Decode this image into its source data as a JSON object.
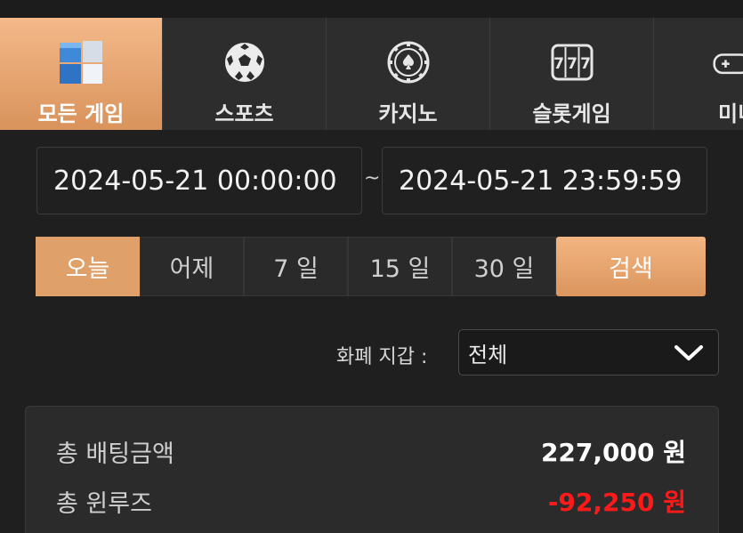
{
  "tabs": [
    {
      "label": "모든 게임",
      "icon": "all-games-cube-icon",
      "active": true
    },
    {
      "label": "스포츠",
      "icon": "soccer-ball-icon",
      "active": false
    },
    {
      "label": "카지노",
      "icon": "casino-chip-icon",
      "active": false
    },
    {
      "label": "슬롯게임",
      "icon": "slot-machine-icon",
      "active": false
    },
    {
      "label": "미니",
      "icon": "gamepad-icon",
      "active": false
    }
  ],
  "date_range": {
    "start": "2024-05-21 00:00:00",
    "separator": "~",
    "end": "2024-05-21 23:59:59"
  },
  "periods": [
    "오늘",
    "어제",
    "7 일",
    "15 일",
    "30 일"
  ],
  "active_period": "오늘",
  "search_label": "검색",
  "currency_filter": {
    "label": "화폐 지갑 :",
    "value": "전체"
  },
  "summary": {
    "total_bet_label": "총 배팅금액",
    "total_bet_value": "227,000 원",
    "total_winloss_label": "총 윈루즈",
    "total_winloss_value": "-92,250 원"
  },
  "colors": {
    "accent": "#e0a06a",
    "negative": "#ff1a1a",
    "background": "#1f1f1f"
  }
}
